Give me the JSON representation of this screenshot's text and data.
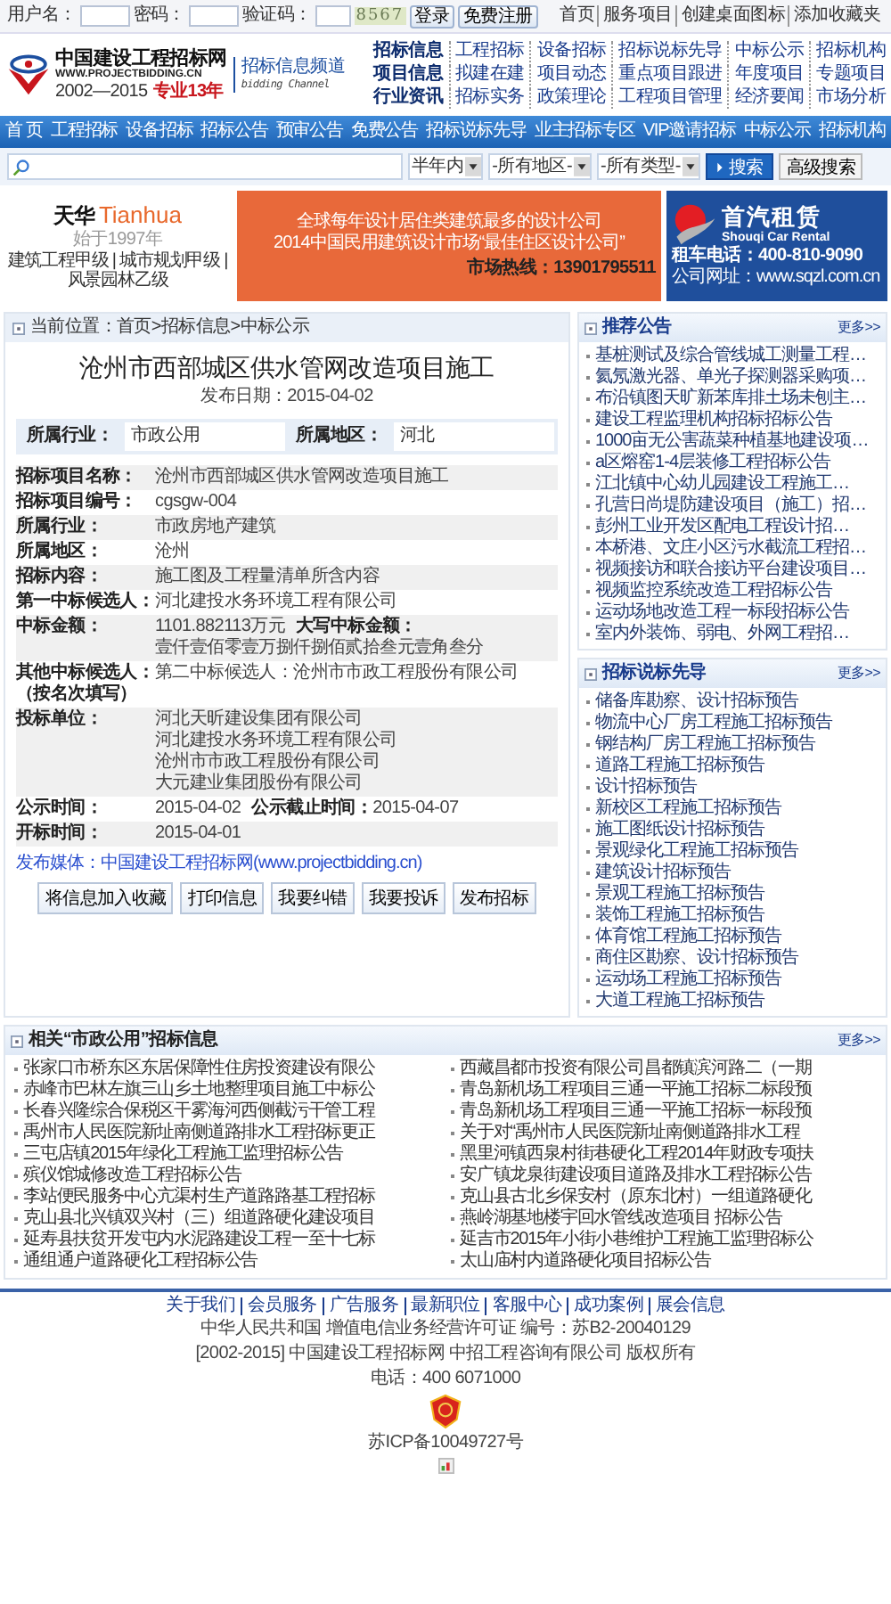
{
  "login_bar": {
    "fields": [
      {
        "label": "用户名："
      },
      {
        "label": "密码："
      },
      {
        "label": "验证码："
      }
    ],
    "captcha": "8567",
    "buttons": [
      "登录",
      "免费注册"
    ],
    "links": [
      "首页",
      "服务项目",
      "创建桌面图标",
      "添加收藏夹"
    ]
  },
  "logo": {
    "name": "中国建设工程招标网",
    "url": "WWW.PROJECTBIDDING.CN",
    "years": "2002—2015",
    "tagline": "专业13年"
  },
  "channel": {
    "title": "招标信息频道",
    "subtitle": "bidding Channel"
  },
  "link_grid": [
    {
      "heading": "招标信息",
      "links": [
        "工程招标",
        "设备招标",
        "招标说标先导",
        "中标公示",
        "招标机构"
      ]
    },
    {
      "heading": "项目信息",
      "links": [
        "拟建在建",
        "项目动态",
        "重点项目跟进",
        "年度项目",
        "专题项目"
      ]
    },
    {
      "heading": "行业资讯",
      "links": [
        "招标实务",
        "政策理论",
        "工程项目管理",
        "经济要闻",
        "市场分析"
      ]
    }
  ],
  "nav": [
    "首 页",
    "工程招标",
    "设备招标",
    "招标公告",
    "预审公告",
    "免费公告",
    "招标说标先导",
    "业主招标专区",
    "VIP邀请招标",
    "中标公示",
    "招标机构"
  ],
  "search": {
    "filters": [
      "半年内",
      "-所有地区-",
      "-所有类型-"
    ],
    "search_button": "搜索",
    "advanced_button": "高级搜索"
  },
  "left_ad": {
    "brand_cn": "天华",
    "brand_en": "Tianhua",
    "since": "始于1997年",
    "qualifications": "建筑工程甲级 | 城市规划甲级 | 风景园林乙级"
  },
  "center_ad": {
    "lines": [
      "全球每年设计居住类建筑最多的设计公司",
      "2014中国民用建筑设计市场“最佳住区设计公司”"
    ],
    "hotline": "市场热线：13901795511"
  },
  "right_ad": {
    "brand_cn": "首汽租赁",
    "brand_en": "Shouqi Car Rental",
    "phone": "租车电话：400-810-9090",
    "site": "公司网址：www.sqzl.com.cn"
  },
  "breadcrumb": "当前位置：首页>招标信息>中标公示",
  "article": {
    "title": "沧州市西部城区供水管网改造项目施工",
    "date": "发布日期：2015-04-02",
    "summary": [
      {
        "label": "所属行业：",
        "value": "市政公用"
      },
      {
        "label": "所属地区：",
        "value": "河北"
      }
    ],
    "rows": [
      {
        "label": "招标项目名称：",
        "lines": [
          "沧州市西部城区供水管网改造项目施工"
        ]
      },
      {
        "label": "招标项目编号：",
        "lines": [
          "cgsgw-004"
        ]
      },
      {
        "label": "所属行业：",
        "lines": [
          "市政房地产建筑"
        ]
      },
      {
        "label": "所属地区：",
        "lines": [
          "沧州"
        ]
      },
      {
        "label": "招标内容：",
        "lines": [
          "施工图及工程量清单所含内容"
        ]
      },
      {
        "label": "第一中标候选人：",
        "lines": [
          "河北建投水务环境工程有限公司"
        ]
      },
      {
        "label": "中标金额：",
        "lines": [
          "1101.882113万元"
        ],
        "extra": {
          "label": "大写中标金额：",
          "value": "壹仟壹佰零壹万捌仟捌佰贰拾叁元壹角叁分"
        }
      },
      {
        "label": "其他中标候选人：",
        "note": "（按名次填写）",
        "lines": [
          "第二中标候选人：沧州市市政工程股份有限公司"
        ]
      },
      {
        "label": "投标单位：",
        "lines": [
          "河北天昕建设集团有限公司",
          "河北建投水务环境工程有限公司",
          "沧州市市政工程股份有限公司",
          "大元建业集团股份有限公司"
        ]
      },
      {
        "label": "公示时间：",
        "lines": [
          "2015-04-02"
        ],
        "extra": {
          "label": "公示截止时间：",
          "value": "2015-04-07"
        }
      },
      {
        "label": "开标时间：",
        "lines": [
          "2015-04-01"
        ]
      }
    ],
    "publisher": "发布媒体：中国建设工程招标网(www.projectbidding.cn)",
    "actions": [
      "将信息加入收藏",
      "打印信息",
      "我要纠错",
      "我要投诉",
      "发布招标"
    ]
  },
  "sidebar": [
    {
      "title": "推荐公告",
      "more": "更多>>",
      "items": [
        "基桩测试及综合管线城工测量工程…",
        "氦氖激光器、单光子探测器采购项…",
        "布沿镇图天旷新苯库排土场未刨主…",
        "建设工程监理机构招标招标公告",
        "1000亩无公害蔬菜种植基地建设项…",
        "a区熔窑1-4层装修工程招标公告",
        "江北镇中心幼儿园建设工程施工…",
        "孔营日尚堤防建设项目（施工）招…",
        "彭州工业开发区配电工程设计招…",
        "本桥港、文庄小区污水截流工程招…",
        "视频接访和联合接访平台建设项目…",
        "视频监控系统改造工程招标公告",
        "运动场地改造工程一标段招标公告",
        "室内外装饰、弱电、外网工程招…"
      ]
    },
    {
      "title": "招标说标先导",
      "more": "更多>>",
      "items": [
        "储备库勘察、设计招标预告",
        "物流中心厂房工程施工招标预告",
        "钢结构厂房工程施工招标预告",
        "道路工程施工招标预告",
        "设计招标预告",
        "新校区工程施工招标预告",
        "施工图纸设计招标预告",
        "景观绿化工程施工招标预告",
        "建筑设计招标预告",
        "景观工程施工招标预告",
        "装饰工程施工招标预告",
        "体育馆工程施工招标预告",
        "商住区勘察、设计招标预告",
        "运动场工程施工招标预告",
        "大道工程施工招标预告"
      ]
    }
  ],
  "related": {
    "title": "相关“市政公用”招标信息",
    "more": "更多>>",
    "columns": [
      [
        "张家口市桥东区东居保障性住房投资建设有限公",
        "赤峰市巴林左旗三山乡土地整理项目施工中标公",
        "长春兴隆综合保税区干雾海河西侧截污干管工程",
        "禹州市人民医院新址南侧道路排水工程招标更正",
        "三屯店镇2015年绿化工程施工监理招标公告",
        "殡仪馆城修改造工程招标公告",
        "李站便民服务中心亢渠村生产道路路基工程招标",
        "克山县北兴镇双兴村（三）组道路硬化建设项目",
        "延寿县扶贫开发屯内水泥路建设工程一至十七标",
        "通组通户道路硬化工程招标公告"
      ],
      [
        "西藏昌都市投资有限公司昌都镇滨河路二（一期",
        "青岛新机场工程项目三通一平施工招标二标段预",
        "青岛新机场工程项目三通一平施工招标一标段预",
        "关于对“禹州市人民医院新址南侧道路排水工程",
        "黑里河镇西泉村街巷硬化工程2014年财政专项扶",
        "安广镇龙泉街建设项目道路及排水工程招标公告",
        "克山县古北乡保安村（原东北村）一组道路硬化",
        "燕岭湖基地楼宇回水管线改造项目 招标公告",
        "延吉市2015年小街小巷维护工程施工监理招标公",
        "太山庙村内道路硬化项目招标公告"
      ]
    ]
  },
  "footer": {
    "links": [
      "关于我们",
      "会员服务",
      "广告服务",
      "最新职位",
      "客服中心",
      "成功案例",
      "展会信息"
    ],
    "lines": [
      "中华人民共和国 增值电信业务经营许可证 编号：苏B2-20040129",
      "[2002-2015] 中国建设工程招标网 中招工程咨询有限公司 版权所有",
      "电话：400 6071000"
    ],
    "icp": "苏ICP备10049727号"
  }
}
